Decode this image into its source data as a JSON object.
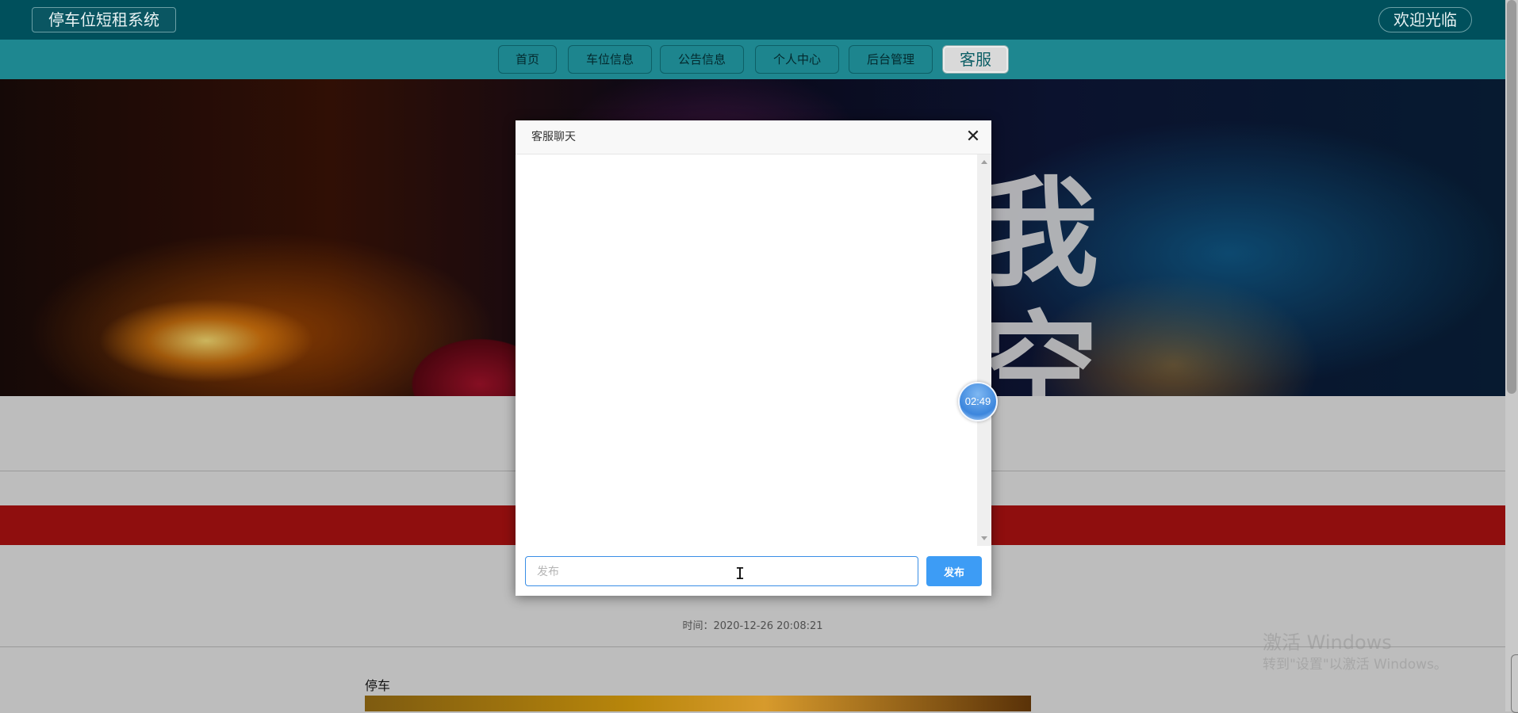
{
  "header": {
    "brand": "停车位短租系统",
    "welcome": "欢迎光临"
  },
  "nav": {
    "items": [
      {
        "label": "首页"
      },
      {
        "label": "车位信息"
      },
      {
        "label": "公告信息"
      },
      {
        "label": "个人中心"
      },
      {
        "label": "后台管理"
      },
      {
        "label": "客服",
        "active": true
      }
    ]
  },
  "banner": {
    "calligraphy": "我\n空"
  },
  "article": {
    "time_label": "时间：2020-12-26 20:08:21",
    "title": "停车"
  },
  "chat_dialog": {
    "title": "客服聊天",
    "close_icon": "close-icon",
    "input_placeholder": "发布",
    "send_label": "发布"
  },
  "timer": {
    "value": "02:49"
  },
  "watermark": {
    "line1": "激活 Windows",
    "line2": "转到\"设置\"以激活 Windows。"
  },
  "colors": {
    "topbar": "#00505c",
    "navbar": "#1e8790",
    "send_button": "#3d9cf5",
    "redbar": "#8f0e0e"
  }
}
